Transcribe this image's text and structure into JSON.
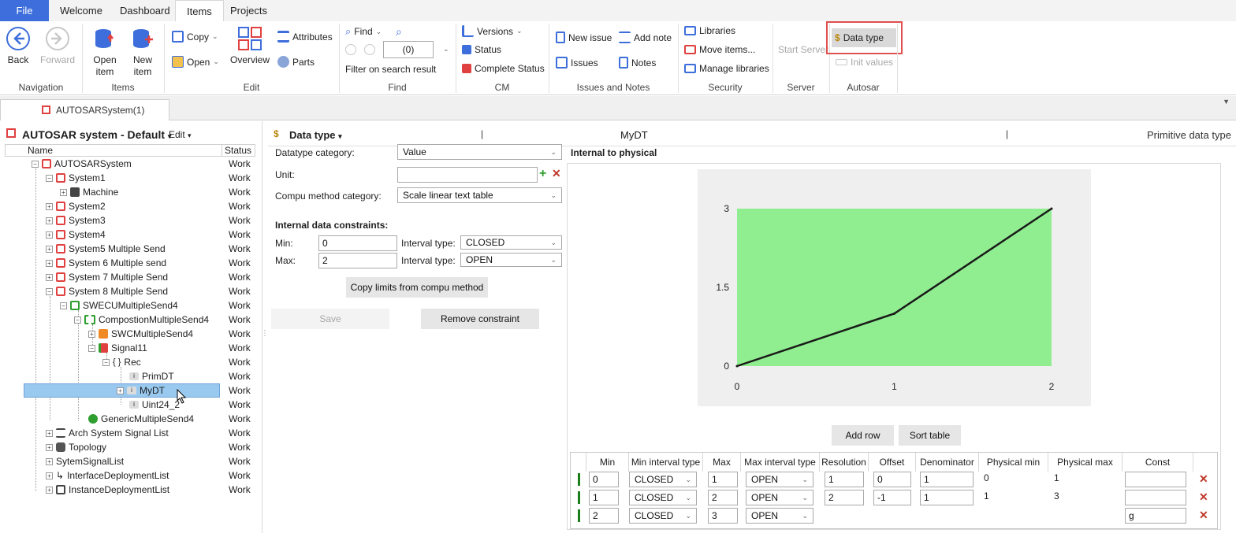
{
  "menu": {
    "tabs": [
      "File",
      "Welcome",
      "Dashboard",
      "Items",
      "Projects"
    ]
  },
  "ribbon": {
    "navigation": {
      "back": "Back",
      "forward": "Forward",
      "label": "Navigation"
    },
    "items": {
      "open": "Open",
      "open2": "item",
      "new": "New",
      "new2": "item",
      "label": "Items"
    },
    "edit": {
      "copy": "Copy",
      "open": "Open",
      "overview": "Overview",
      "attributes": "Attributes",
      "parts": "Parts",
      "label": "Edit"
    },
    "find": {
      "find": "Find",
      "count": "(0)",
      "filter": "Filter on search result",
      "label": "Find"
    },
    "cm": {
      "versions": "Versions",
      "status": "Status",
      "complete": "Complete Status",
      "label": "CM"
    },
    "issues": {
      "new_issue": "New issue",
      "add_note": "Add note",
      "issues": "Issues",
      "notes": "Notes",
      "label": "Issues and Notes"
    },
    "security": {
      "libraries": "Libraries",
      "move": "Move items...",
      "manage": "Manage libraries",
      "label": "Security"
    },
    "server": {
      "start": "Start Server",
      "label": "Server"
    },
    "autosar": {
      "data_type": "Data type",
      "init_values": "Init values",
      "label": "Autosar"
    }
  },
  "doc_tab": {
    "title": "AUTOSARSystem(1)"
  },
  "tree": {
    "title": "AUTOSAR system - Default",
    "edit": "Edit",
    "col_name": "Name",
    "col_status": "Status",
    "nodes": [
      {
        "label": "AUTOSARSystem",
        "status": "Work"
      },
      {
        "label": "System1",
        "status": "Work"
      },
      {
        "label": "Machine",
        "status": "Work"
      },
      {
        "label": "System2",
        "status": "Work"
      },
      {
        "label": "System3",
        "status": "Work"
      },
      {
        "label": "System4",
        "status": "Work"
      },
      {
        "label": "System5 Multiple Send",
        "status": "Work"
      },
      {
        "label": "System 6 Multiple send",
        "status": "Work"
      },
      {
        "label": "System 7 Multiple Send",
        "status": "Work"
      },
      {
        "label": "System 8 Multiple Send",
        "status": "Work"
      },
      {
        "label": "SWECUMultipleSend4",
        "status": "Work"
      },
      {
        "label": "CompostionMultipleSend4",
        "status": "Work"
      },
      {
        "label": "SWCMultipleSend4",
        "status": "Work"
      },
      {
        "label": "Signal11",
        "status": "Work"
      },
      {
        "label": "Rec",
        "status": "Work"
      },
      {
        "label": "PrimDT",
        "status": "Work"
      },
      {
        "label": "MyDT",
        "status": "Work"
      },
      {
        "label": "Uint24_2",
        "status": "Work"
      },
      {
        "label": "GenericMultipleSend4",
        "status": "Work"
      },
      {
        "label": "Arch System Signal List",
        "status": "Work"
      },
      {
        "label": "Topology",
        "status": "Work"
      },
      {
        "label": "SytemSignalList",
        "status": "Work"
      },
      {
        "label": "InterfaceDeploymentList",
        "status": "Work"
      },
      {
        "label": "InstanceDeploymentList",
        "status": "Work"
      }
    ]
  },
  "editor": {
    "header": "Data type",
    "name": "MyDT",
    "kind": "Primitive data type",
    "category_label": "Datatype category:",
    "category_value": "Value",
    "unit_label": "Unit:",
    "unit_value": "",
    "compu_label": "Compu method category:",
    "compu_value": "Scale linear text table",
    "constraints_title": "Internal data constraints:",
    "min_label": "Min:",
    "min_value": "0",
    "max_label": "Max:",
    "max_value": "2",
    "interval_label": "Interval type:",
    "min_interval": "CLOSED",
    "max_interval": "OPEN",
    "copy_limits": "Copy limits from compu method",
    "save": "Save",
    "remove": "Remove constraint",
    "chart_title": "Internal to physical",
    "add_row": "Add row",
    "sort_table": "Sort table"
  },
  "chart_data": {
    "type": "line",
    "x": [
      0,
      1,
      2
    ],
    "series": [
      {
        "values": [
          0,
          1,
          3
        ]
      }
    ],
    "xticks": [
      "0",
      "1",
      "2"
    ],
    "yticks": [
      "0",
      "1.5",
      "3"
    ],
    "xlim": [
      0,
      2
    ],
    "ylim": [
      0,
      3
    ],
    "fill": "#90ee90",
    "line_color": "#1a1a1a"
  },
  "table": {
    "headers": [
      "Min",
      "Min interval type",
      "Max",
      "Max interval type",
      "Resolution",
      "Offset",
      "Denominator",
      "Physical min",
      "Physical max",
      "Const"
    ],
    "rows": [
      {
        "min": "0",
        "min_type": "CLOSED",
        "max": "1",
        "max_type": "OPEN",
        "resolution": "1",
        "offset": "0",
        "denominator": "1",
        "phys_min": "0",
        "phys_max": "1",
        "const": ""
      },
      {
        "min": "1",
        "min_type": "CLOSED",
        "max": "2",
        "max_type": "OPEN",
        "resolution": "2",
        "offset": "-1",
        "denominator": "1",
        "phys_min": "1",
        "phys_max": "3",
        "const": ""
      },
      {
        "min": "2",
        "min_type": "CLOSED",
        "max": "3",
        "max_type": "OPEN",
        "resolution": "",
        "offset": "",
        "denominator": "",
        "phys_min": "",
        "phys_max": "",
        "const": "g"
      }
    ]
  }
}
